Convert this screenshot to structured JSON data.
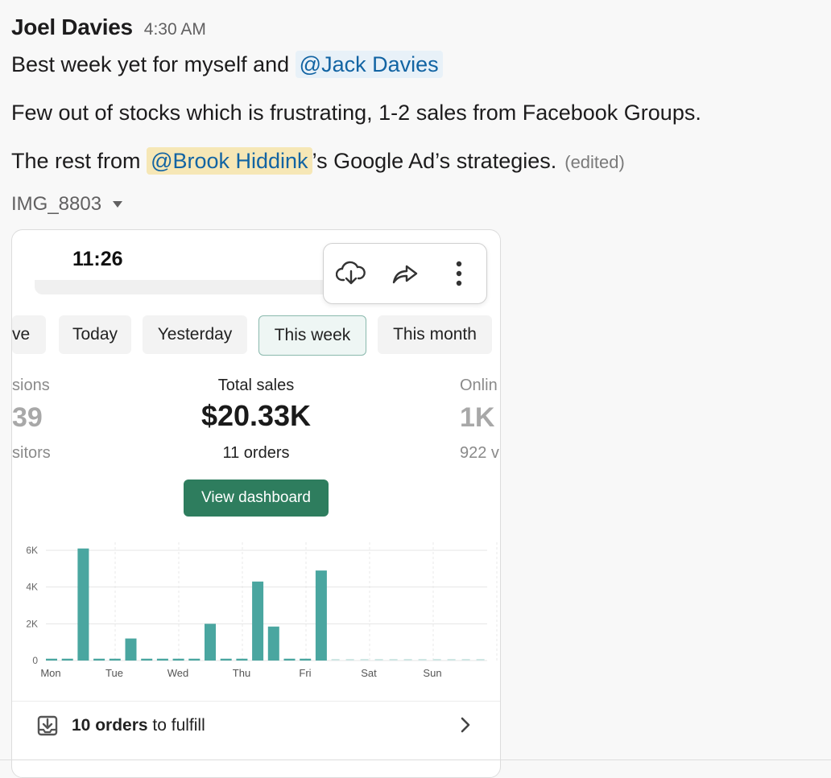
{
  "message": {
    "author": "Joel Davies",
    "time": "4:30 AM",
    "line1_text": "Best week yet for myself and",
    "line1_mention": "@Jack Davies",
    "line2": "Few out of stocks which is frustrating, 1-2 sales from Facebook Groups.",
    "line3_pre": "The rest from",
    "line3_mention": "@Brook Hiddink",
    "line3_post": "’s Google Ad’s strategies.",
    "edited": "(edited)"
  },
  "attachment": {
    "filename": "IMG_8803",
    "phone_time": "11:26",
    "toolbar": [
      "download-icon",
      "share-icon",
      "more-icon"
    ],
    "tabs": [
      {
        "label": "ve",
        "active": false
      },
      {
        "label": "Today",
        "active": false
      },
      {
        "label": "Yesterday",
        "active": false
      },
      {
        "label": "This week",
        "active": true
      },
      {
        "label": "This month",
        "active": false
      }
    ],
    "left_stat": {
      "label": "sions",
      "value": "39",
      "sub": "sitors"
    },
    "center_stat": {
      "label": "Total sales",
      "value": "$20.33K",
      "sub": "11 orders"
    },
    "right_stat": {
      "label": "Onlin",
      "value": "1K",
      "sub": "922 v"
    },
    "dashboard_button": "View dashboard",
    "fulfill": {
      "count": "10 orders",
      "rest": " to fulfill"
    }
  },
  "chart_data": {
    "type": "bar",
    "ylim": [
      0,
      6000
    ],
    "yticks": [
      "0",
      "2K",
      "4K",
      "6K"
    ],
    "days": [
      "Mon",
      "Tue",
      "Wed",
      "Thu",
      "Fri",
      "Sat",
      "Sun"
    ],
    "values": [
      100,
      100,
      6100,
      100,
      100,
      1200,
      100,
      100,
      100,
      100,
      2000,
      100,
      100,
      4300,
      1850,
      100,
      100,
      4900
    ],
    "grid": true,
    "color": "#4aa6a0"
  }
}
